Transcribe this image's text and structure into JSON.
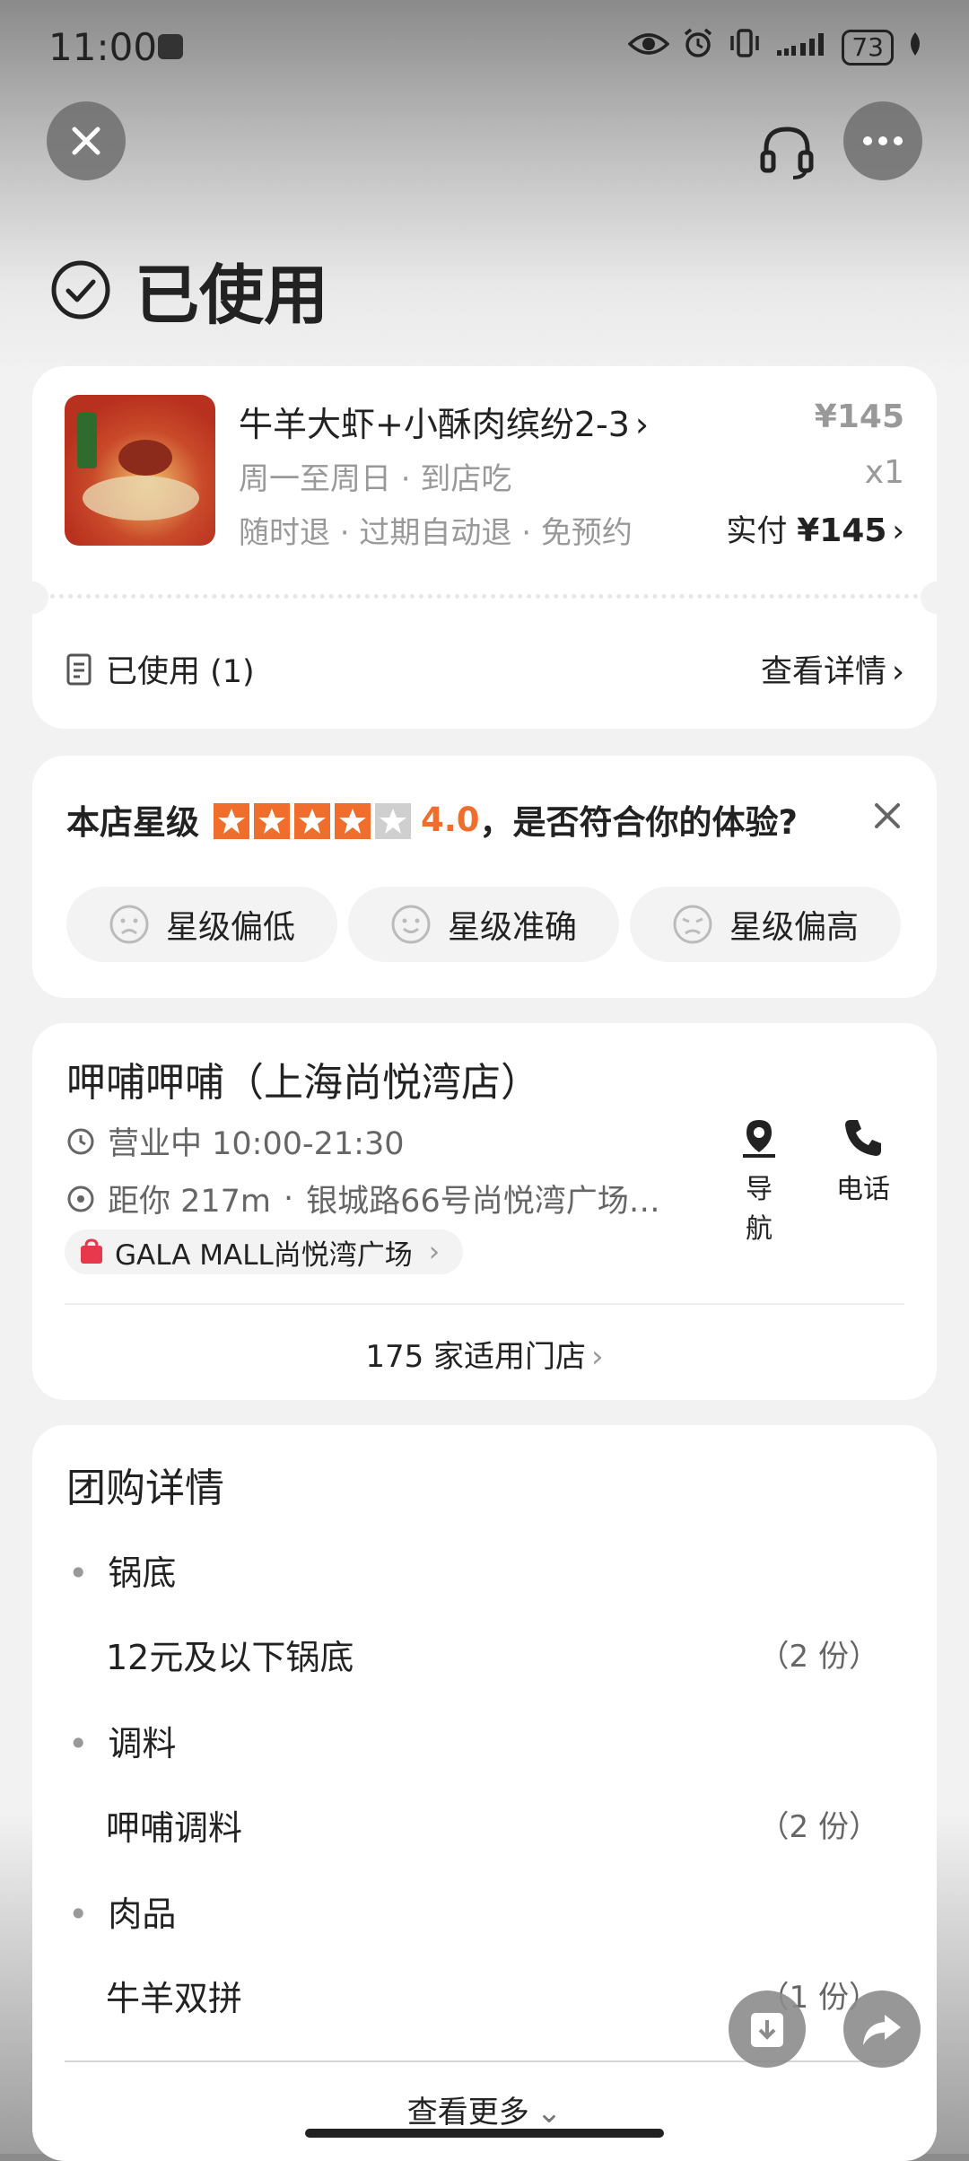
{
  "status_bar": {
    "time": "11:00",
    "battery": "73"
  },
  "header": {
    "status_title": "已使用"
  },
  "order": {
    "product_name": "牛羊大虾+小酥肉缤纷2-3",
    "price": "¥145",
    "usage": "周一至周日 · 到店吃",
    "quantity": "x1",
    "policy": "随时退 · 过期自动退 · 免预约",
    "paid_label": "实付",
    "paid_amount": "¥145",
    "used_label": "已使用 (1)",
    "details_link": "查看详情"
  },
  "rating": {
    "label": "本店星级",
    "score": "4.0",
    "stars_filled": 4,
    "stars_total": 5,
    "question": "，是否符合你的体验?",
    "options": [
      "星级偏低",
      "星级准确",
      "星级偏高"
    ]
  },
  "store": {
    "name": "呷哺呷哺（上海尚悦湾店）",
    "hours": "营业中 10:00-21:30",
    "distance": "距你 217m",
    "address": "银城路66号尚悦湾广场…",
    "mall": "GALA MALL尚悦湾广场",
    "nav_label": "导航",
    "phone_label": "电话",
    "stores_link": "175 家适用门店"
  },
  "deal": {
    "title": "团购详情",
    "sections": [
      {
        "title": "锅底",
        "item": "12元及以下锅底",
        "qty": "（2 份）"
      },
      {
        "title": "调料",
        "item": "呷哺调料",
        "qty": "（2 份）"
      },
      {
        "title": "肉品",
        "item": "牛羊双拼",
        "qty": "（1 份）"
      }
    ],
    "more": "查看更多"
  },
  "colors": {
    "accent": "#f06d2c",
    "card": "#ffffff",
    "text": "#222222"
  }
}
